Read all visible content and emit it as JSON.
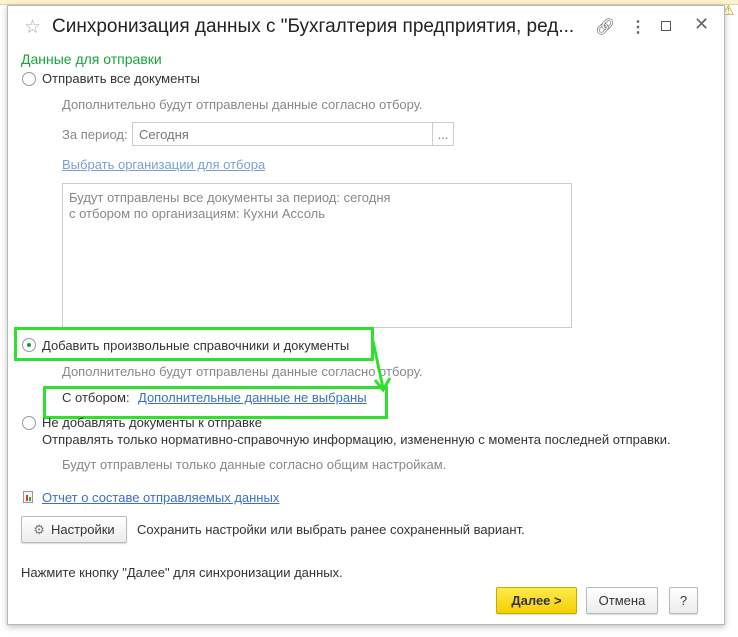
{
  "window": {
    "title": "Синхронизация данных с \"Бухгалтерия предприятия, ред...",
    "icons": [
      "star-icon",
      "link-icon",
      "more-icon",
      "maximize-icon",
      "close-icon"
    ]
  },
  "section_title": "Данные для отправки",
  "option_all": {
    "label": "Отправить все документы",
    "note": "Дополнительно будут отправлены данные согласно отбору.",
    "period_label": "За период:",
    "period_value": "Сегодня",
    "period_button": "...",
    "org_link": "Выбрать организации для отбора",
    "summary": [
      "Будут отправлены все документы за период: сегодня",
      "с отбором по организациям: Кухни Ассоль"
    ],
    "selected": false
  },
  "option_custom": {
    "label": "Добавить произвольные справочники и документы",
    "note": "Дополнительно будут отправлены данные согласно отбору.",
    "filter_label": "С отбором:",
    "filter_link": "Дополнительные данные не выбраны",
    "selected": true
  },
  "option_none": {
    "label": "Не добавлять документы к отправке",
    "description": "Отправлять только нормативно-справочную информацию, измененную с момента последней отправки.",
    "note": "Будут отправлены только данные согласно общим настройкам.",
    "selected": false
  },
  "report_link": "Отчет о составе отправляемых данных",
  "settings": {
    "button": "Настройки",
    "description": "Сохранить настройки или выбрать ранее сохраненный вариант."
  },
  "footer_hint": "Нажмите кнопку \"Далее\" для синхронизации данных.",
  "buttons": {
    "next": "Далее >",
    "cancel": "Отмена",
    "help": "?"
  },
  "colors": {
    "accent_green": "#1aa33b",
    "highlight": "#2fe02f",
    "primary_button": "#f4d000",
    "link": "#3b6fc9"
  }
}
